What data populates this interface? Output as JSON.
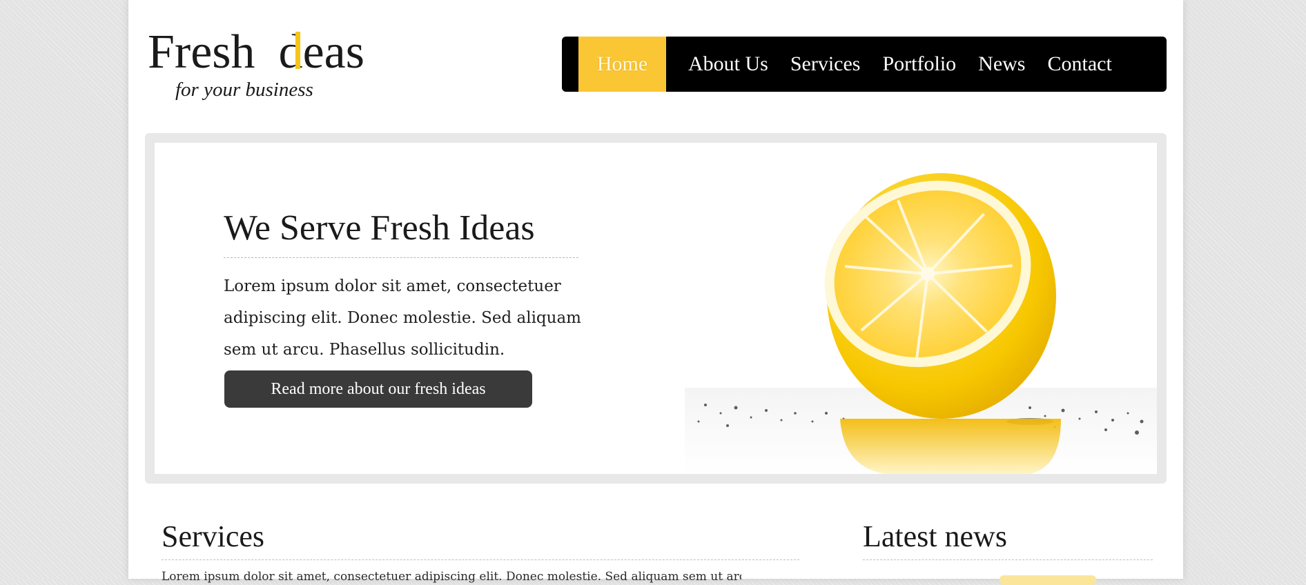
{
  "brand": {
    "logo_word1": "Fresh",
    "logo_word2": "deas",
    "tagline": "for your business"
  },
  "colors": {
    "accent": "#fbc634",
    "nav_bg": "#000000",
    "button_bg": "#3a3a3a"
  },
  "nav": {
    "items": [
      {
        "label": "Home",
        "active": true
      },
      {
        "label": "About Us"
      },
      {
        "label": "Services"
      },
      {
        "label": "Portfolio"
      },
      {
        "label": "News"
      },
      {
        "label": "Contact"
      }
    ]
  },
  "hero": {
    "title": "We Serve Fresh Ideas",
    "text": "Lorem ipsum dolor sit amet, consectetuer adipiscing elit. Donec molestie. Sed aliquam sem ut arcu. Phasellus sollicitudin.",
    "button_label": "Read more about our fresh ideas",
    "image_icon": "lemon-image"
  },
  "services": {
    "title": "Services",
    "text": "Lorem ipsum dolor sit amet, consectetuer adipiscing elit. Donec molestie. Sed aliquam sem ut arcu."
  },
  "news": {
    "title": "Latest news"
  }
}
